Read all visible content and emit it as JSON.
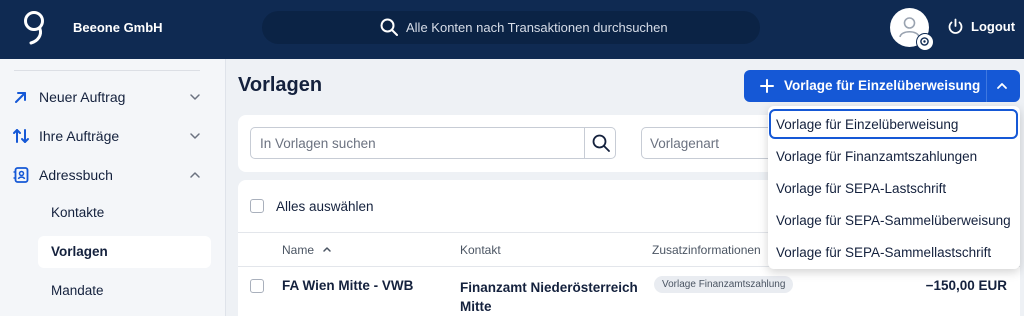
{
  "header": {
    "company": "Beeone GmbH",
    "search_placeholder": "Alle Konten nach Transaktionen durchsuchen",
    "logout_label": "Logout"
  },
  "sidebar": {
    "items": [
      {
        "label": "Neuer Auftrag",
        "icon": "arrow-up-right-icon",
        "expanded": false
      },
      {
        "label": "Ihre Aufträge",
        "icon": "arrows-up-down-icon",
        "expanded": false
      },
      {
        "label": "Adressbuch",
        "icon": "address-book-icon",
        "expanded": true
      }
    ],
    "subitems": [
      "Kontakte",
      "Vorlagen",
      "Mandate"
    ],
    "active_subitem": "Vorlagen"
  },
  "main": {
    "title": "Vorlagen",
    "primary_button": "Vorlage für Einzelüberweisung",
    "search_placeholder": "In Vorlagen suchen",
    "type_placeholder": "Vorlagenart",
    "select_all": "Alles auswählen",
    "columns": {
      "name": "Name",
      "contact": "Kontakt",
      "info": "Zusatzinformationen"
    },
    "rows": [
      {
        "name": "FA Wien Mitte - VWB",
        "contact": "Finanzamt Niederösterreich Mitte",
        "badge": "Vorlage Finanzamtszahlung",
        "amount": "−150,00 EUR"
      }
    ]
  },
  "dropdown": {
    "items": [
      "Vorlage für Einzelüberweisung",
      "Vorlage für Finanzamtszahlungen",
      "Vorlage für SEPA-Lastschrift",
      "Vorlage für SEPA-Sammelüberweisung",
      "Vorlage für SEPA-Sammellastschrift"
    ]
  },
  "colors": {
    "navy": "#0f2a52",
    "primary": "#1558d6",
    "background": "#eef1f5"
  }
}
